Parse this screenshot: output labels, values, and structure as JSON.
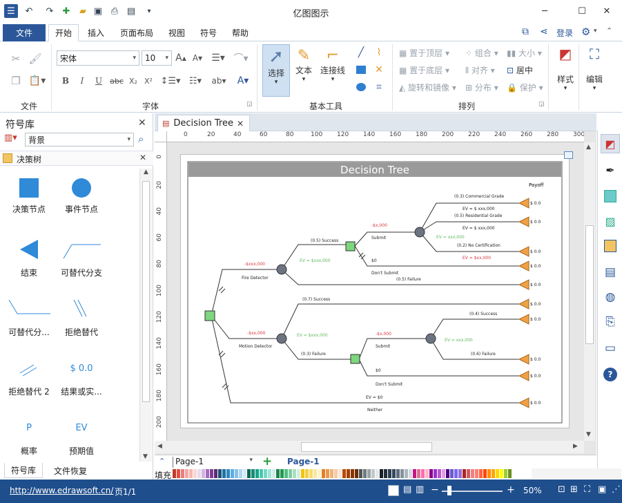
{
  "app": {
    "title": "亿图图示"
  },
  "ribbon_tabs": [
    "文件",
    "开始",
    "插入",
    "页面布局",
    "视图",
    "符号",
    "帮助"
  ],
  "account": {
    "login": "登录"
  },
  "font": {
    "name": "宋体",
    "size": "10"
  },
  "groups": {
    "file": "文件",
    "font": "字体",
    "tools": "基本工具",
    "arrange": "排列"
  },
  "tools": {
    "select": "选择",
    "text": "文本",
    "connector": "连接线"
  },
  "arrange": {
    "bring_front": "置于顶层",
    "send_back": "置于底层",
    "rotate": "旋转和镜像",
    "group": "组合",
    "align": "对齐",
    "distribute": "分布",
    "size": "大小",
    "center": "居中",
    "protect": "保护"
  },
  "style_btn": "样式",
  "edit_btn": "编辑",
  "library": {
    "title": "符号库",
    "search_value": "背景",
    "section": "决策树",
    "shapes": [
      "决策节点",
      "事件节点",
      "结束",
      "可替代分支",
      "可替代分...",
      "拒绝替代",
      "拒绝替代 2",
      "结果或实...",
      "概率",
      "预期值"
    ],
    "glyph_p": "P",
    "glyph_ev": "EV",
    "glyph_value": "$ 0.0"
  },
  "bottom_tabs": [
    "符号库",
    "文件恢复"
  ],
  "document": {
    "tab": "Decision Tree"
  },
  "ruler_h": [
    "0",
    "20",
    "40",
    "60",
    "80",
    "100",
    "120",
    "140",
    "160",
    "180",
    "200",
    "220",
    "240",
    "260",
    "280",
    "300"
  ],
  "ruler_v": [
    "0",
    "20",
    "40",
    "60",
    "80",
    "100",
    "120",
    "140",
    "160",
    "180",
    "200"
  ],
  "diagram": {
    "title": "Decision Tree",
    "payoff_header": "Payoff",
    "payoff": "$ 0.0",
    "fire_cost": "-$xxx,000",
    "fire_label": "Fire Detector",
    "success_05": "(0.5) Success",
    "ev_fire": "EV = $xxx,000",
    "submit_cost": "-$x,000",
    "submit": "Submit",
    "commercial": "(0.3) Commercial Grade",
    "ev1": "EV = $ xxx,000",
    "residential": "(0.5) Residential Grade",
    "ev2": "EV = $ xxx,000",
    "ev3": "EV = xxx,000",
    "no_cert": "(0.2) No Certification",
    "ev4": "EV = $xx,000",
    "zero": "$0",
    "dont_submit": "Don't Submit",
    "failure_05": "(0.5) Failure",
    "success_07": "(0.7) Success",
    "motion_cost": "-$xx,000",
    "motion_label": "Motion Detector",
    "ev_motion": "EV = $xxx,000",
    "failure_03": "(0.3) Failure",
    "submit_cost2": "-$x,000",
    "submit2": "Submit",
    "success_04": "(0.4) Success",
    "ev5": "EV = xxx,000",
    "failure_06": "(0.6) Failure",
    "zero2": "$0",
    "dont_submit2": "Don't Submit",
    "ev_neither": "EV = $0",
    "neither": "Neither"
  },
  "page_nav": {
    "current": "Page-1",
    "active": "Page-1"
  },
  "fill_label": "填充",
  "status": {
    "url": "http://www.edrawsoft.cn/",
    "page": "页1/1",
    "zoom": "50%"
  },
  "colors": {
    "accent": "#2b579a",
    "status_bar": "#1f4e8c",
    "decision_node": "#7ed67e",
    "chance_node": "#6b7480",
    "end_node": "#f0a046",
    "ev_green": "#5cb85c",
    "cost_red": "#d9363e"
  }
}
